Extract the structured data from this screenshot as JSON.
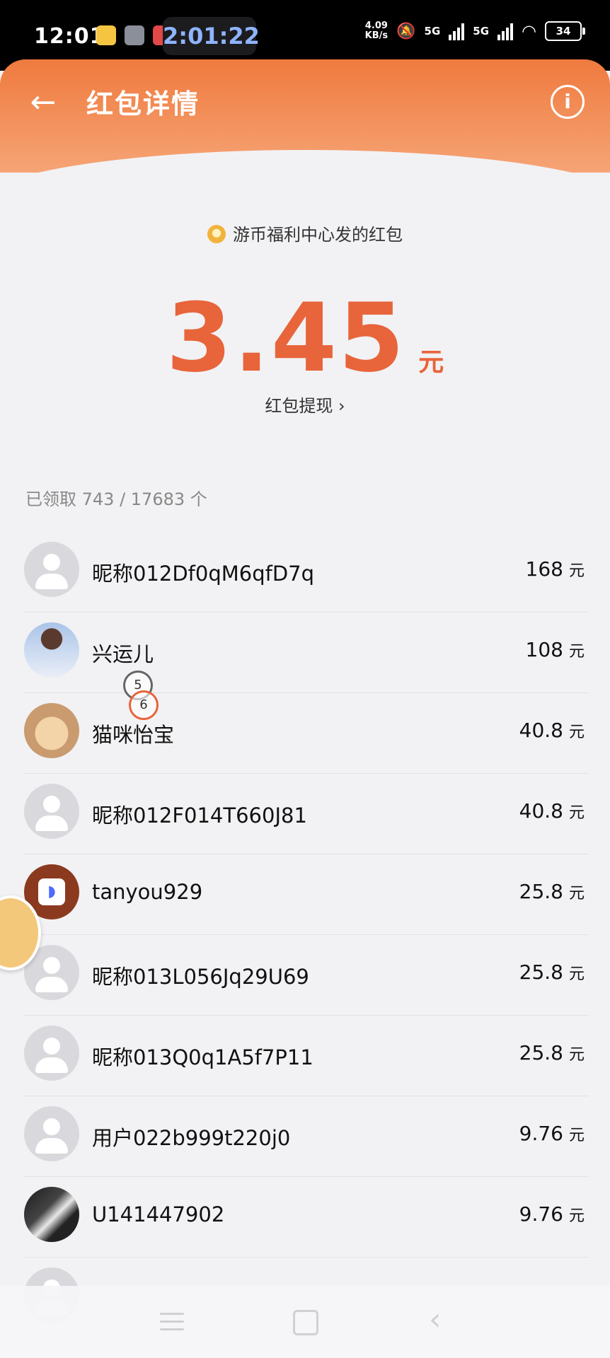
{
  "status_bar": {
    "time": "12:01",
    "clock_pill": "2:01:22",
    "net_speed_value": "4.09",
    "net_speed_unit": "KB/s",
    "signal_1": "5G",
    "signal_2": "5G",
    "wifi_label": "6",
    "battery": "34"
  },
  "header": {
    "title": "红包详情",
    "back_icon": "back-arrow-icon",
    "info_icon": "info-icon",
    "gradient_colors": [
      "#ef7a3e",
      "#f6a476"
    ]
  },
  "red_packet": {
    "sender_text": "游币福利中心发的红包",
    "amount": "3.45",
    "unit": "元",
    "withdraw_label": "红包提现 ›",
    "accent_color": "#e8643b"
  },
  "claimed": {
    "summary": "已领取 743 / 17683 个"
  },
  "list": {
    "unit": "元",
    "items": [
      {
        "name": "昵称012Df0qM6qfD7q",
        "amount": "168"
      },
      {
        "name": "兴运儿",
        "amount": "108"
      },
      {
        "name": "猫咪怡宝",
        "amount": "40.8"
      },
      {
        "name": "昵称012F014T660J81",
        "amount": "40.8"
      },
      {
        "name": "tanyou929",
        "amount": "25.8"
      },
      {
        "name": "昵称013L056Jq29U69",
        "amount": "25.8"
      },
      {
        "name": "昵称013Q0q1A5f7P11",
        "amount": "25.8"
      },
      {
        "name": "用户022b999t220j0",
        "amount": "9.76"
      },
      {
        "name": "U141447902",
        "amount": "9.76"
      }
    ]
  },
  "touch_markers": [
    "5",
    "6"
  ],
  "nav": {
    "menu_icon": "menu-icon",
    "home_icon": "home-icon",
    "back_icon": "back-icon"
  }
}
